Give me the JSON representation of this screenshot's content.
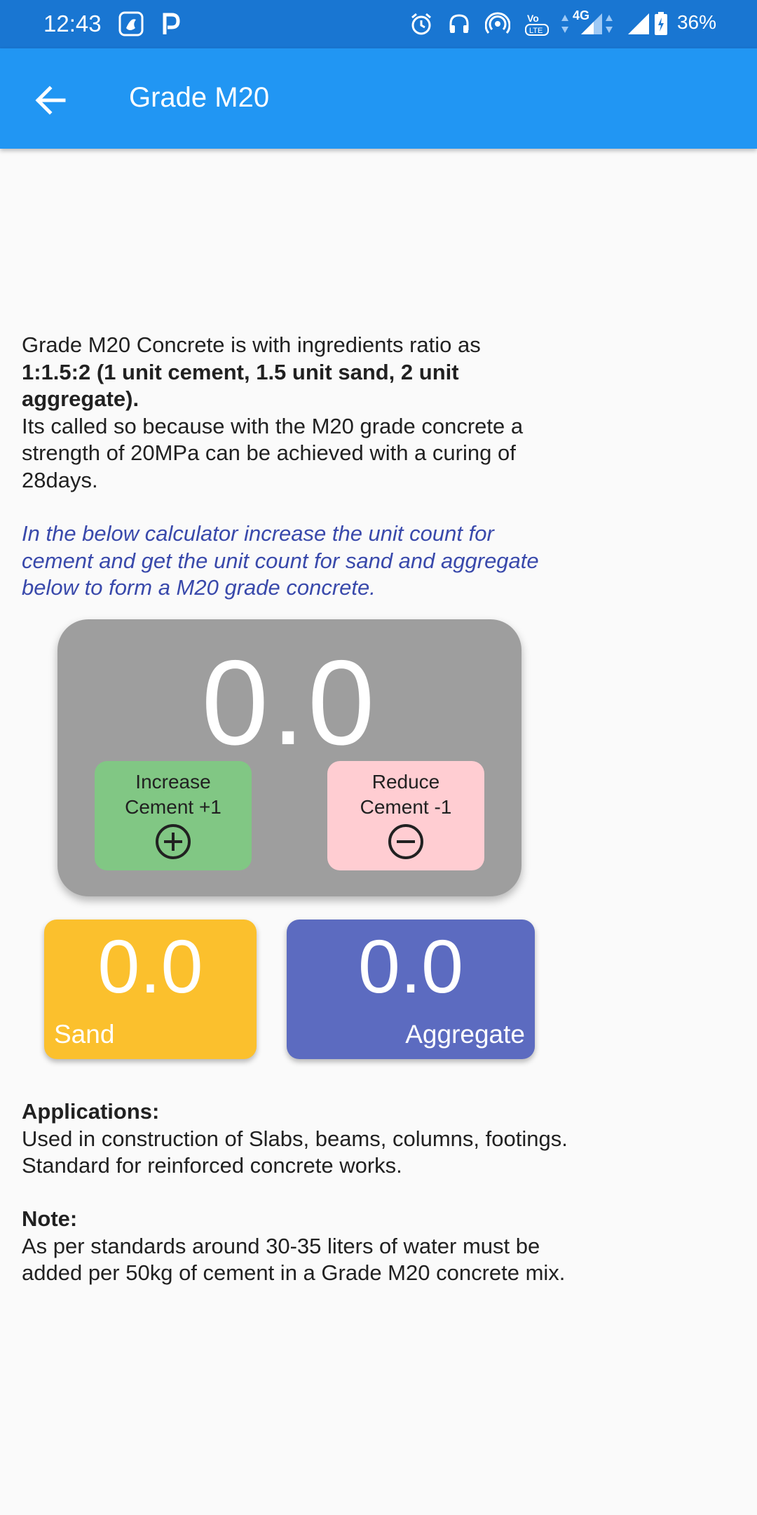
{
  "status_bar": {
    "time": "12:43",
    "network": "4G",
    "battery": "36%",
    "icons": [
      "jiosaavn-icon",
      "paytm-icon",
      "alarm-icon",
      "headphones-icon",
      "hotspot-icon",
      "volte-icon",
      "signal-icon",
      "signal-icon-2",
      "battery-icon"
    ]
  },
  "app_bar": {
    "title": "Grade M20",
    "back_icon": "arrow-back-icon"
  },
  "intro": {
    "line1": "Grade M20 Concrete is with ingredients ratio as",
    "ratio_bold": "1:1.5:2 (1 unit cement, 1.5 unit sand, 2 unit aggregate).",
    "desc": "Its called so because with the M20 grade concrete a strength of 20MPa can be achieved with a curing of 28days."
  },
  "hint": "In the below calculator increase the unit count for cement and get the unit count for sand and aggregate below to form a M20 grade concrete.",
  "calculator": {
    "cement_value": "0.0",
    "increase_label_line1": "Increase",
    "increase_label_line2": "Cement +1",
    "reduce_label_line1": "Reduce",
    "reduce_label_line2": "Cement -1",
    "increase_icon": "add-circle-icon",
    "reduce_icon": "remove-circle-icon",
    "card_color": "#9e9e9e",
    "increase_color": "#81c784",
    "reduce_color": "#ffcdd2"
  },
  "results": {
    "sand_value": "0.0",
    "sand_label": "Sand",
    "sand_color": "#fbc02d",
    "aggregate_value": "0.0",
    "aggregate_label": "Aggregate",
    "aggregate_color": "#5c6bc0"
  },
  "applications": {
    "heading": "Applications:",
    "text": "Used in construction of Slabs, beams, columns, footings. Standard for reinforced concrete works."
  },
  "note": {
    "heading": "Note:",
    "text": "As per standards around 30-35 liters of water must be added per 50kg of cement in a Grade M20 concrete mix."
  },
  "colors": {
    "primary": "#2196f3",
    "primary_dark": "#1976d2",
    "hint_text": "#3949ab"
  }
}
